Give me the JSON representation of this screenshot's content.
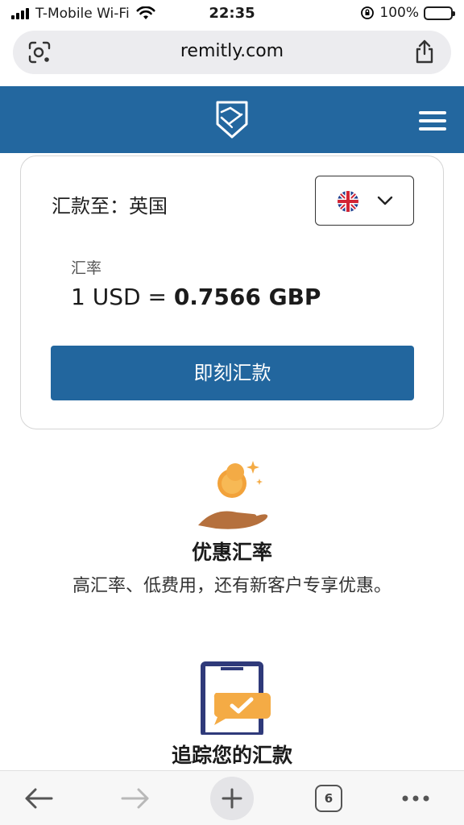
{
  "status_bar": {
    "carrier": "T-Mobile Wi-Fi",
    "time": "22:35",
    "battery": "100%"
  },
  "browser": {
    "url": "remitly.com",
    "tab_count": "6"
  },
  "card": {
    "send_to_label": "汇款至：",
    "country": "英国",
    "rate_label": "汇率",
    "rate_prefix": "1 USD = ",
    "rate_value": "0.7566 GBP",
    "send_button": "即刻汇款"
  },
  "features": [
    {
      "title": "优惠汇率",
      "description": "高汇率、低费用，还有新客户专享优惠。",
      "icon": "coin-hand-icon"
    },
    {
      "title": "追踪您的汇款",
      "icon": "phone-check-icon"
    }
  ],
  "colors": {
    "brand_blue": "#23679f",
    "coin": "#f4a93b",
    "hand": "#b5703d"
  }
}
